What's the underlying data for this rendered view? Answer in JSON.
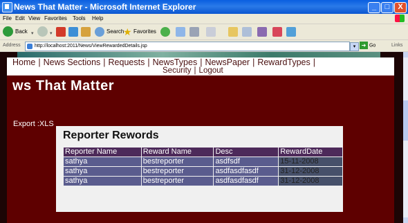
{
  "window": {
    "title": "News That Matter - Microsoft Internet Explorer",
    "buttons": [
      "_",
      "□",
      "X"
    ]
  },
  "menu": [
    "File",
    "Edit",
    "View",
    "Favorites",
    "Tools",
    "Help"
  ],
  "toolbar": {
    "back_label": "Back",
    "search_label": "Search",
    "favorites_label": "Favorites"
  },
  "address": {
    "label": "Address",
    "url": "http://localhost:2011/News/ViewRewardedDetails.jsp",
    "go_label": "Go",
    "links_label": "Links"
  },
  "nav": {
    "row1": [
      "Home",
      "News Sections",
      "Requests",
      "NewsTypes",
      "NewsPaper",
      "RewardTypes"
    ],
    "row2": [
      "Security",
      "Logout"
    ]
  },
  "page": {
    "site_title": "ws That Matter",
    "export_prefix": "Export :",
    "export_link": "XLS"
  },
  "rewards": {
    "title": "Reporter Rewords",
    "columns": [
      "Reporter Name",
      "Reward Name",
      "Desc",
      "RewardDate"
    ],
    "rows": [
      [
        "sathya",
        "bestreporter",
        "asdfsdf",
        "15-11-2008"
      ],
      [
        "sathya",
        "bestreporter",
        "asdfasdfasdf",
        "31-12-2008"
      ],
      [
        "sathya",
        "bestreporter",
        "asdfasdfasdf",
        "31-12-2008"
      ]
    ]
  },
  "colors": {
    "content_bg": "#5e0000",
    "header_row": "#4d2a5a",
    "data_row": "#5a5c8e"
  }
}
